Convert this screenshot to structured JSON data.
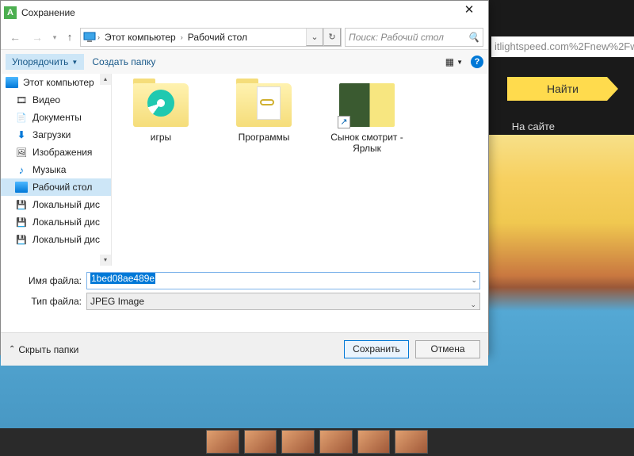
{
  "browser": {
    "url_fragment": "itlightspeed.com%2Fnew%2Fw",
    "find_button": "Найти",
    "site_label": "На сайте"
  },
  "dialog": {
    "title": "Сохранение",
    "path": {
      "segment1": "Этот компьютер",
      "segment2": "Рабочий стол"
    },
    "search_placeholder": "Поиск: Рабочий стол",
    "toolbar": {
      "organize": "Упорядочить",
      "new_folder": "Создать папку"
    },
    "sidebar": {
      "items": [
        {
          "label": "Этот компьютер"
        },
        {
          "label": "Видео"
        },
        {
          "label": "Документы"
        },
        {
          "label": "Загрузки"
        },
        {
          "label": "Изображения"
        },
        {
          "label": "Музыка"
        },
        {
          "label": "Рабочий стол"
        },
        {
          "label": "Локальный дис"
        },
        {
          "label": "Локальный дис"
        },
        {
          "label": "Локальный дис"
        }
      ]
    },
    "content": {
      "items": [
        {
          "label": "игры"
        },
        {
          "label": "Программы"
        },
        {
          "label": "Сынок смотрит - Ярлык"
        }
      ]
    },
    "fields": {
      "filename_label": "Имя файла:",
      "filename_value": "1bed08ae489e",
      "filetype_label": "Тип файла:",
      "filetype_value": "JPEG Image"
    },
    "footer": {
      "hide_folders": "Скрыть папки",
      "save": "Сохранить",
      "cancel": "Отмена"
    }
  }
}
